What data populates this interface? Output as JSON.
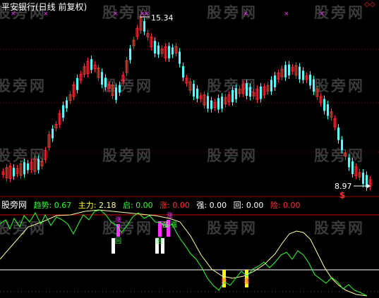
{
  "main_panel": {
    "title": "平安银行(日线 前复权)",
    "high_label": "15.34",
    "low_label": "8.97",
    "marker_symbol": "$",
    "x_marker": "×",
    "diamond_icon": "◇◇"
  },
  "indicator_panel": {
    "name": "股旁网",
    "fields": [
      {
        "label": "趋势:",
        "value": "0.67",
        "color": "#33ff33"
      },
      {
        "label": "主力:",
        "value": "2.18",
        "color": "#ffff33"
      },
      {
        "label": "启:",
        "value": "0.00",
        "color": "#33ff33"
      },
      {
        "label": "涨:",
        "value": "0.00",
        "color": "#ff3333"
      },
      {
        "label": "强:",
        "value": "0.00",
        "color": "#ffffff"
      },
      {
        "label": "回:",
        "value": "0.00",
        "color": "#ffffff"
      },
      {
        "label": "险:",
        "value": "0.00",
        "color": "#ff3333"
      }
    ],
    "bar_labels": {
      "qi": "启",
      "qiang": "强",
      "zhang": "涨",
      "hui": "回",
      "xian": "险"
    }
  },
  "watermark": "股旁网",
  "colors": {
    "up": "#ff3333",
    "down": "#54ffff",
    "trend": "#33ff33",
    "main": "#ffff99",
    "bar_magenta": "#ff33ff",
    "bar_yellow": "#ffff00"
  }
}
